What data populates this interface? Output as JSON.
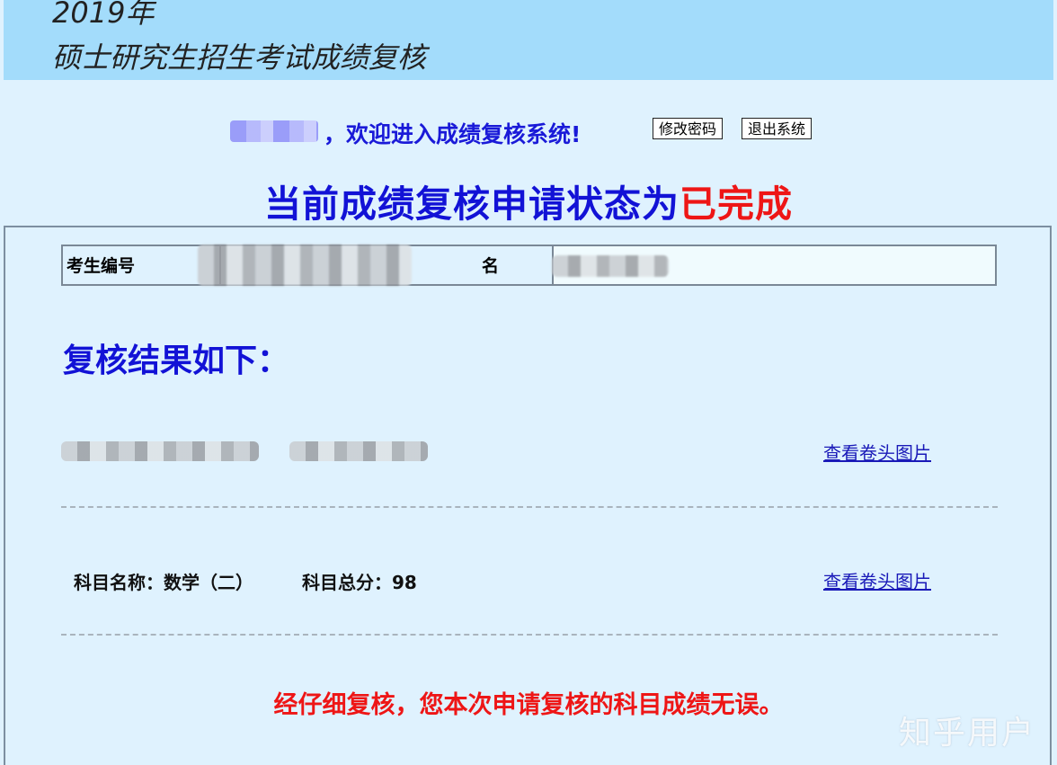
{
  "header": {
    "year": "2019年",
    "title": "硕士研究生招生考试成绩复核"
  },
  "welcome": {
    "text": "，欢迎进入成绩复核系统!",
    "change_password": "修改密码",
    "logout": "退出系统"
  },
  "status": {
    "prefix": "当前成绩复核申请状态为",
    "value": "已完成"
  },
  "info": {
    "id_label": "考生编号",
    "name_label": "名"
  },
  "results": {
    "title": "复核结果如下：",
    "view_link": "查看卷头图片",
    "subject_name": "科目名称：数学（二）",
    "subject_score": "科目总分：98",
    "conclusion": "经仔细复核，您本次申请复核的科目成绩无误。"
  },
  "watermark": "知乎用户",
  "colors": {
    "header_bg": "#a3dcfb",
    "page_bg": "#dff2fe",
    "primary_blue": "#1212d6",
    "alert_red": "#ee1616"
  }
}
